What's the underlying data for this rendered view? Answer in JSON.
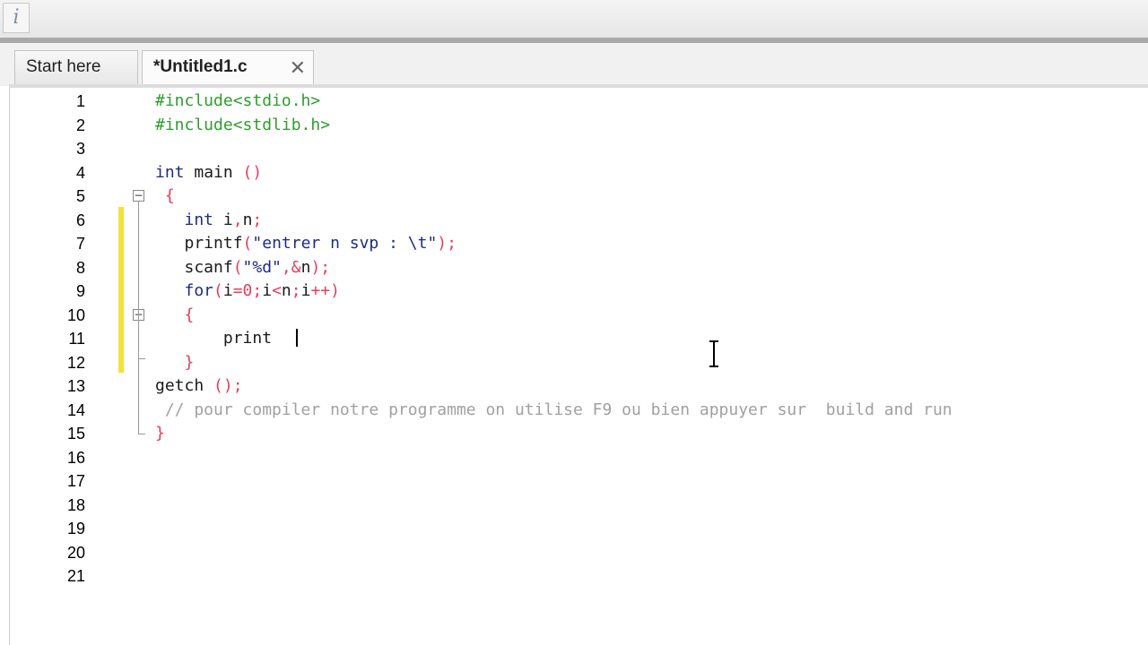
{
  "toolbar": {
    "app_icon": "i"
  },
  "tabs": [
    {
      "label": "Start here"
    },
    {
      "label": "*Untitled1.c",
      "close": "✕"
    }
  ],
  "editor": {
    "lines": [
      {
        "num": "1",
        "tokens": [
          {
            "t": "#include<stdio.h>",
            "c": "pp"
          }
        ]
      },
      {
        "num": "2",
        "tokens": [
          {
            "t": "#include<stdlib.h>",
            "c": "pp"
          }
        ]
      },
      {
        "num": "3",
        "tokens": []
      },
      {
        "num": "4",
        "tokens": [
          {
            "t": "int",
            "c": "kw"
          },
          {
            "t": " main ",
            "c": "tx"
          },
          {
            "t": "()",
            "c": "pn"
          }
        ]
      },
      {
        "num": "5",
        "tokens": [
          {
            "t": " {",
            "c": "pn"
          }
        ]
      },
      {
        "num": "6",
        "tokens": [
          {
            "t": "   int",
            "c": "kw"
          },
          {
            "t": " i",
            "c": "tx"
          },
          {
            "t": ",",
            "c": "pn"
          },
          {
            "t": "n",
            "c": "tx"
          },
          {
            "t": ";",
            "c": "pn"
          }
        ]
      },
      {
        "num": "7",
        "tokens": [
          {
            "t": "   printf",
            "c": "tx"
          },
          {
            "t": "(",
            "c": "pn"
          },
          {
            "t": "\"entrer n svp : \\t\"",
            "c": "str"
          },
          {
            "t": ");",
            "c": "pn"
          }
        ]
      },
      {
        "num": "8",
        "tokens": [
          {
            "t": "   scanf",
            "c": "tx"
          },
          {
            "t": "(",
            "c": "pn"
          },
          {
            "t": "\"%d\"",
            "c": "str"
          },
          {
            "t": ",&",
            "c": "pn"
          },
          {
            "t": "n",
            "c": "tx"
          },
          {
            "t": ");",
            "c": "pn"
          }
        ]
      },
      {
        "num": "9",
        "tokens": [
          {
            "t": "   for",
            "c": "kw"
          },
          {
            "t": "(",
            "c": "pn"
          },
          {
            "t": "i",
            "c": "tx"
          },
          {
            "t": "=0;",
            "c": "pn"
          },
          {
            "t": "i",
            "c": "tx"
          },
          {
            "t": "<",
            "c": "pn"
          },
          {
            "t": "n",
            "c": "tx"
          },
          {
            "t": ";",
            "c": "pn"
          },
          {
            "t": "i",
            "c": "tx"
          },
          {
            "t": "++)",
            "c": "pn"
          }
        ]
      },
      {
        "num": "10",
        "tokens": [
          {
            "t": "   {",
            "c": "pn"
          }
        ]
      },
      {
        "num": "11",
        "tokens": [
          {
            "t": "       print",
            "c": "tx"
          }
        ]
      },
      {
        "num": "12",
        "tokens": [
          {
            "t": "   }",
            "c": "pn"
          }
        ]
      },
      {
        "num": "13",
        "tokens": [
          {
            "t": "getch ",
            "c": "tx"
          },
          {
            "t": "();",
            "c": "pn"
          }
        ]
      },
      {
        "num": "14",
        "tokens": [
          {
            "t": " // pour compiler notre programme on utilise F9 ou bien appuyer sur  build and run",
            "c": "cm"
          }
        ]
      },
      {
        "num": "15",
        "tokens": [
          {
            "t": "}",
            "c": "pn"
          }
        ]
      },
      {
        "num": "16",
        "tokens": []
      },
      {
        "num": "17",
        "tokens": []
      },
      {
        "num": "18",
        "tokens": []
      },
      {
        "num": "19",
        "tokens": []
      },
      {
        "num": "20",
        "tokens": []
      },
      {
        "num": "21",
        "tokens": []
      }
    ]
  }
}
